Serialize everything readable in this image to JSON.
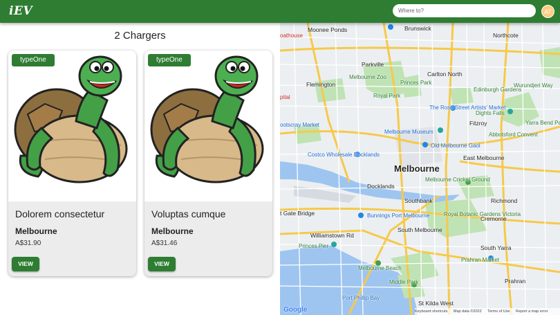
{
  "app": {
    "logo": "iEV"
  },
  "search": {
    "placeholder": "Where to?"
  },
  "user": {
    "initials": "AT"
  },
  "list": {
    "title": "2 Chargers",
    "cards": [
      {
        "badge": "typeOne",
        "title": "Dolorem consectetur",
        "city": "Melbourne",
        "price": "A$31.90",
        "button": "VIEW"
      },
      {
        "badge": "typeOne",
        "title": "Voluptas cumque",
        "city": "Melbourne",
        "price": "A$31.46",
        "button": "VIEW"
      }
    ]
  },
  "map": {
    "labels": {
      "moonee": "Moonee Ponds",
      "brunswick": "Brunswick",
      "northcote": "Northcote",
      "boathouse": "oathouse",
      "parkville": "Parkville",
      "carlton": "Carlton North",
      "flemington": "Flemington",
      "zoo": "Melbourne Zoo",
      "edinburgh": "Edinburgh Gardens",
      "fitzroy": "Fitzroy",
      "dights": "Dights Falls",
      "yarra": "Yarra Bend Park",
      "footscray": "ootscray Market",
      "royalpark": "Royal Park",
      "princespark": "Princes Park",
      "rosestreet": "The Rose Street Artists' Market",
      "museum": "Melbourne Museum",
      "gaol": "Old Melbourne Gaol",
      "abbotsford": "Abbotsford Convent",
      "costco": "Costco Wholesale Docklands",
      "melbourne": "Melbourne",
      "eastmelb": "East Melbourne",
      "docklands": "Docklands",
      "cricket": "Melbourne Cricket Ground",
      "southbank": "Southbank",
      "richmond": "Richmond",
      "gate": "t Gate Bridge",
      "bunnings": "Bunnings Port Melbourne",
      "royalbot": "Royal Botanic Gardens Victoria",
      "cremorne": "Cremorne",
      "southmelb": "South Melbourne",
      "williamstown": "Williamstown Rd",
      "princespier": "Princes Pier",
      "southyarra": "South Yarra",
      "mbeach": "Melbourne Beach",
      "prahran": "Prahran Market",
      "middlepark": "Middle Park",
      "portphillip": "Port Phillip Bay",
      "stkilda": "St Kilda West",
      "prahran2": "Prahran",
      "hospital": "pital",
      "wurundjeri": "Wurundjeri Way"
    },
    "footer": {
      "shortcuts": "Keyboard shortcuts",
      "data": "Map data ©2022",
      "terms": "Terms of Use",
      "report": "Report a map error"
    },
    "google": "Google"
  }
}
